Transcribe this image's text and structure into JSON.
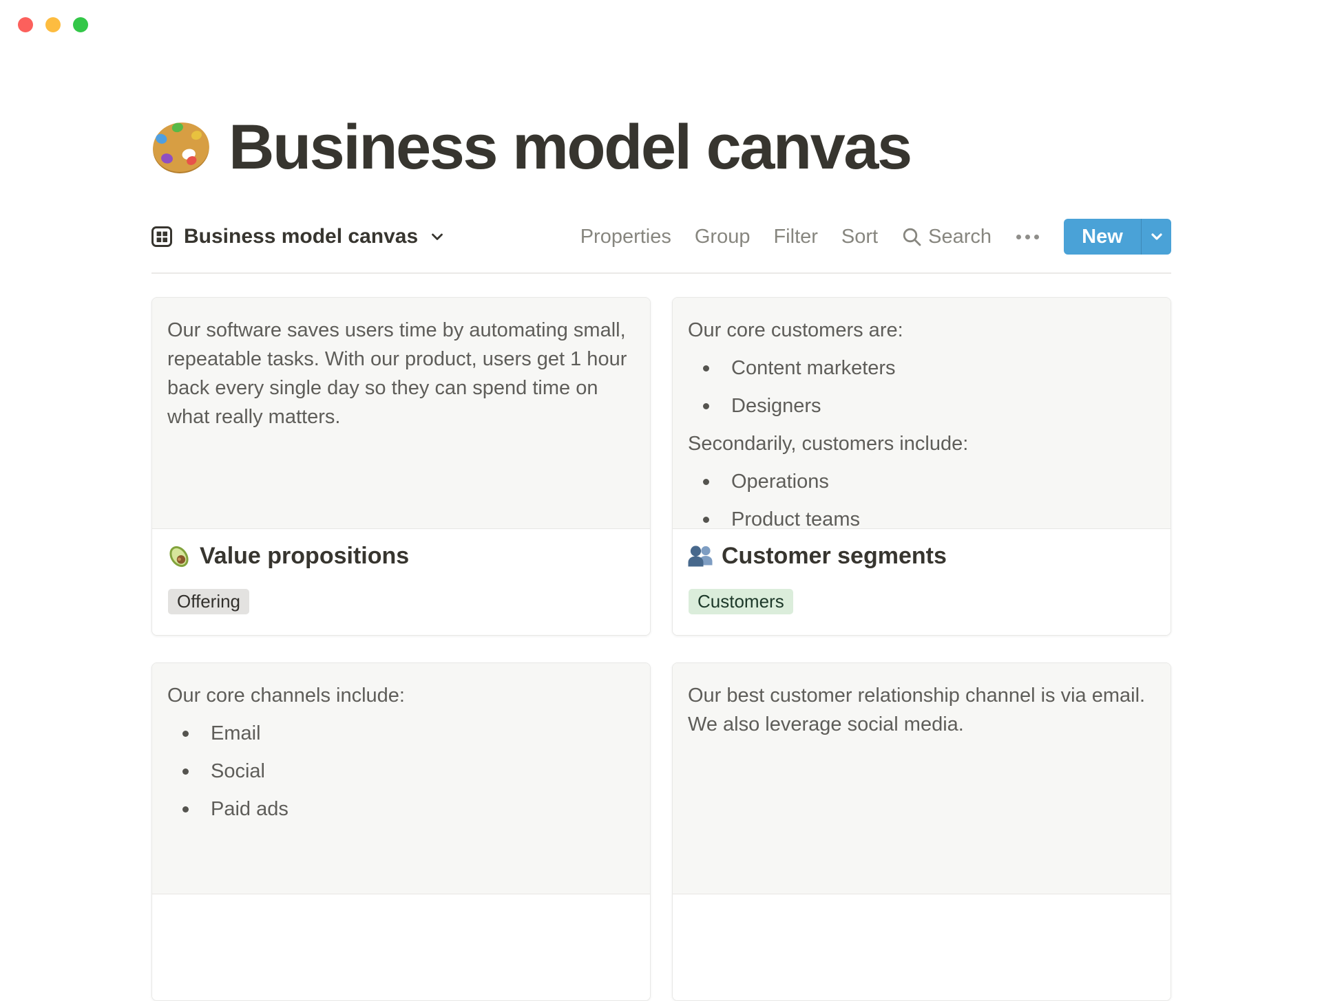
{
  "window": {
    "controls": [
      "close",
      "minimize",
      "zoom"
    ],
    "control_colors": {
      "close": "#FC605C",
      "minimize": "#FDBC40",
      "zoom": "#33C748"
    }
  },
  "page": {
    "icon": "palette-emoji-icon",
    "title": "Business model canvas"
  },
  "toolbar": {
    "view_icon": "gallery-view-icon",
    "view_name": "Business model canvas",
    "menu_items": [
      "Properties",
      "Group",
      "Filter",
      "Sort"
    ],
    "search_label": "Search",
    "more_icon": "more-options-icon",
    "new_button_label": "New"
  },
  "colors": {
    "accent_blue": "#4AA2D7",
    "preview_background": "#F7F7F5",
    "card_border": "#E8E8E6",
    "preview_text": "#5E5D59",
    "heading_text": "#37352F",
    "toolbar_gray_text": "#87867F"
  },
  "cards": [
    {
      "icon": "avocado-emoji-icon",
      "title": "Value propositions",
      "tag": {
        "label": "Offering",
        "bg": "#E3E2E0",
        "text_color": "#32302C"
      },
      "preview_blocks": [
        {
          "type": "paragraph",
          "text": "Our software saves users time by automating small, repeatable tasks. With our product, users get 1 hour back every single day so they can spend time on what really matters."
        }
      ]
    },
    {
      "icon": "busts-in-silhouette-emoji-icon",
      "title": "Customer segments",
      "tag": {
        "label": "Customers",
        "bg": "#DBEDDB",
        "text_color": "#1C3829"
      },
      "preview_blocks": [
        {
          "type": "paragraph",
          "text": "Our core customers are:"
        },
        {
          "type": "bullet",
          "text": "Content marketers"
        },
        {
          "type": "bullet",
          "text": "Designers"
        },
        {
          "type": "paragraph",
          "text": "Secondarily, customers include:"
        },
        {
          "type": "bullet",
          "text": "Operations"
        },
        {
          "type": "bullet",
          "text": "Product teams"
        }
      ]
    },
    {
      "preview_blocks": [
        {
          "type": "paragraph",
          "text": "Our core channels include:"
        },
        {
          "type": "bullet",
          "text": "Email"
        },
        {
          "type": "bullet",
          "text": "Social"
        },
        {
          "type": "bullet",
          "text": "Paid ads"
        }
      ]
    },
    {
      "preview_blocks": [
        {
          "type": "paragraph",
          "text": "Our best customer relationship channel is via email. We also leverage social media."
        }
      ]
    }
  ]
}
